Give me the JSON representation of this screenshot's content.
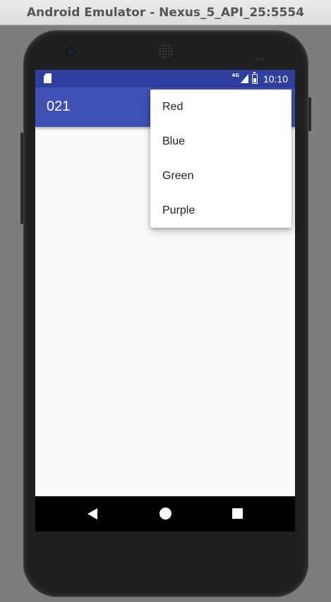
{
  "window": {
    "title": "Android Emulator - Nexus_5_API_25:5554"
  },
  "statusbar": {
    "network": "4G",
    "time": "10:10"
  },
  "appbar": {
    "title": "021"
  },
  "menu": {
    "items": [
      "Red",
      "Blue",
      "Green",
      "Purple"
    ]
  },
  "colors": {
    "primary": "#3f51b5",
    "primary_dark": "#303f9f",
    "screen_bg": "#fafafa",
    "navbar_bg": "#000000"
  },
  "icons": {
    "statusbar": [
      "sd-card-icon",
      "signal-icon",
      "battery-icon"
    ],
    "navbar": [
      "back-icon",
      "home-icon",
      "recents-icon"
    ]
  }
}
